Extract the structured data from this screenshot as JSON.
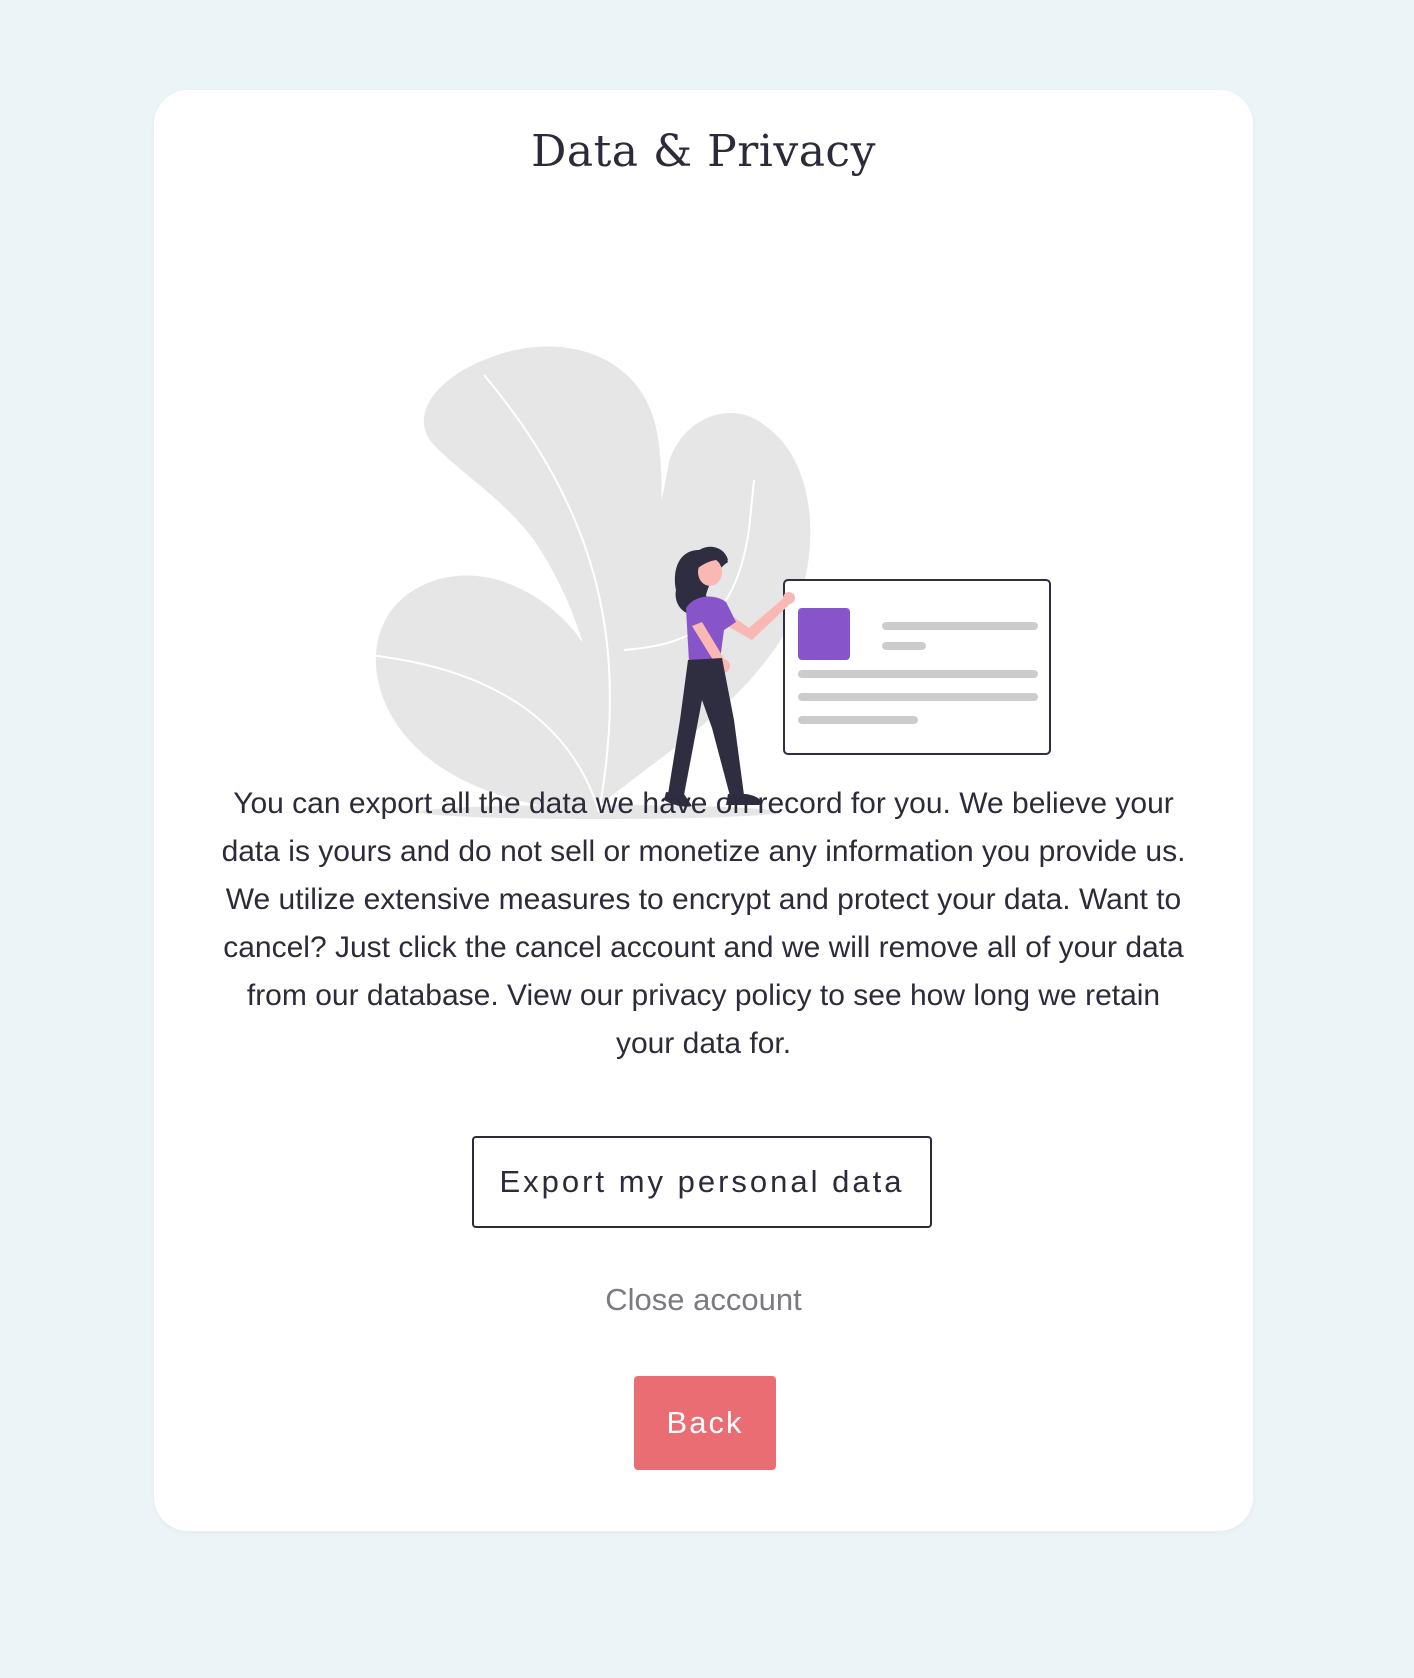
{
  "page": {
    "title": "Data & Privacy",
    "description": "You can export all the data we have on record for you. We believe your data is yours and do not sell or monetize any information you provide us. We utilize extensive measures to encrypt and protect your data. Want to cancel? Just click the cancel account and we will remove all of your data from our database. View our privacy policy to see how long we retain your data for.",
    "export_button_label": "Export my personal data",
    "close_account_label": "Close account",
    "back_button_label": "Back"
  },
  "colors": {
    "background": "#ecf4f7",
    "card": "#ffffff",
    "accent_purple": "#8755c9",
    "back_button": "#e96d73",
    "text_dark": "#2b2b3a",
    "text_muted": "#7a7a80"
  },
  "illustration": {
    "icon": "person-with-profile-card-illustration"
  }
}
